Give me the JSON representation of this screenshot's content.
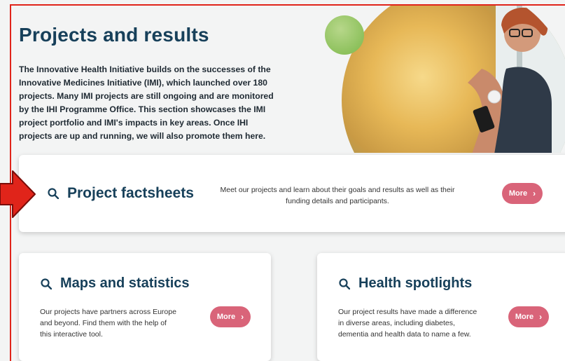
{
  "header": {
    "title": "Projects and results",
    "intro": "The Innovative Health Initiative builds on the successes of the Innovative Medicines Initiative (IMI), which launched over 180 projects. Many IMI projects are still ongoing and are monitored by the IHI Programme Office. This section showcases the IMI project portfolio and IMI's impacts in key areas. Once IHI projects are up and running, we will also promote them here."
  },
  "cards": {
    "factsheets": {
      "title": "Project factsheets",
      "description": "Meet our projects and learn about their goals and results as well as their funding details and participants.",
      "button": "More"
    },
    "maps": {
      "title": "Maps and statistics",
      "description": "Our projects have partners across Europe and beyond. Find them with the help of this interactive tool.",
      "button": "More"
    },
    "spotlights": {
      "title": "Health spotlights",
      "description": "Our project results have made a difference in diverse areas, including diabetes, dementia and health data to name a few.",
      "button": "More"
    }
  },
  "icons": {
    "search": "search-icon",
    "chevron": "chevron-right-icon",
    "pointer": "red-arrow-icon"
  },
  "colors": {
    "title": "#17405a",
    "button": "#d96479",
    "annotation": "#e0241a"
  }
}
